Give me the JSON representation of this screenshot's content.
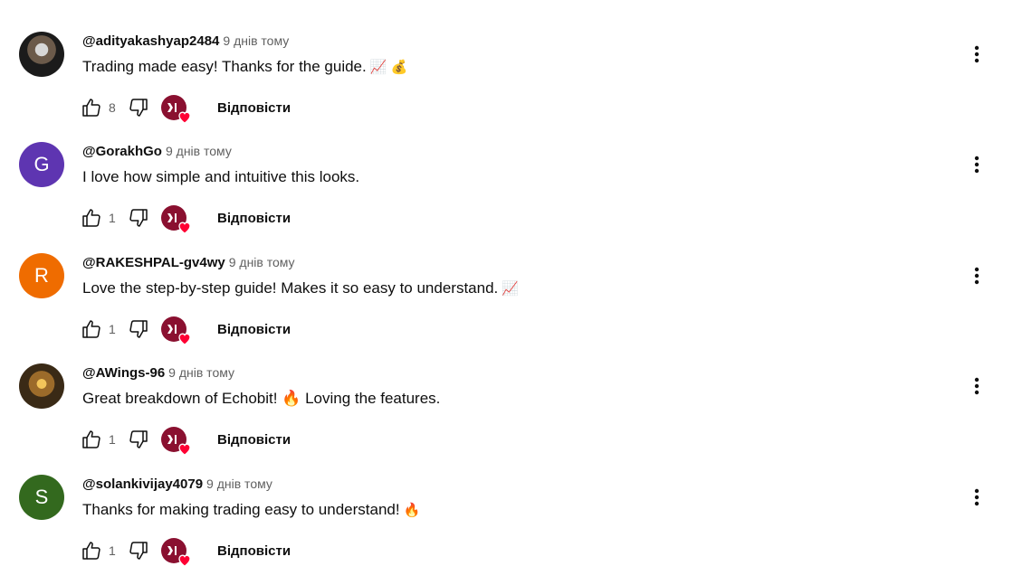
{
  "comments": [
    {
      "author": "@adityakashyap2484",
      "time": "9 днів тому",
      "text": "Trading made easy! Thanks for the guide.",
      "emojis": "📈 💰",
      "likes": "8",
      "avatar_letter": "",
      "avatar_color": "#2b2b2b",
      "avatar_type": "photo"
    },
    {
      "author": "@GorakhGo",
      "time": "9 днів тому",
      "text": "I love how simple and intuitive this looks.",
      "emojis": "",
      "likes": "1",
      "avatar_letter": "G",
      "avatar_color": "#5e35b1",
      "avatar_type": "letter"
    },
    {
      "author": "@RAKESHPAL-gv4wy",
      "time": "9 днів тому",
      "text": "Love the step-by-step guide! Makes it so easy to understand.",
      "emojis": "📈",
      "likes": "1",
      "avatar_letter": "R",
      "avatar_color": "#ef6c00",
      "avatar_type": "letter"
    },
    {
      "author": "@AWings-96",
      "time": "9 днів тому",
      "text": "Great breakdown of Echobit! 🔥 Loving the features.",
      "emojis": "",
      "likes": "1",
      "avatar_letter": "",
      "avatar_color": "#3a2a16",
      "avatar_type": "photo2"
    },
    {
      "author": "@solankivijay4079",
      "time": "9 днів тому",
      "text": "Thanks for making trading easy to understand!",
      "emojis": "🔥",
      "likes": "1",
      "avatar_letter": "S",
      "avatar_color": "#33691e",
      "avatar_type": "letter"
    }
  ],
  "reply_label": "Відповісти",
  "icons": {
    "like": "thumb-up-icon",
    "dislike": "thumb-down-icon",
    "heart": "creator-heart-icon",
    "more": "more-vert-icon"
  },
  "colors": {
    "heart": "#ff0033",
    "creator_avatar": "#8a1030",
    "meta_text": "#606060"
  }
}
